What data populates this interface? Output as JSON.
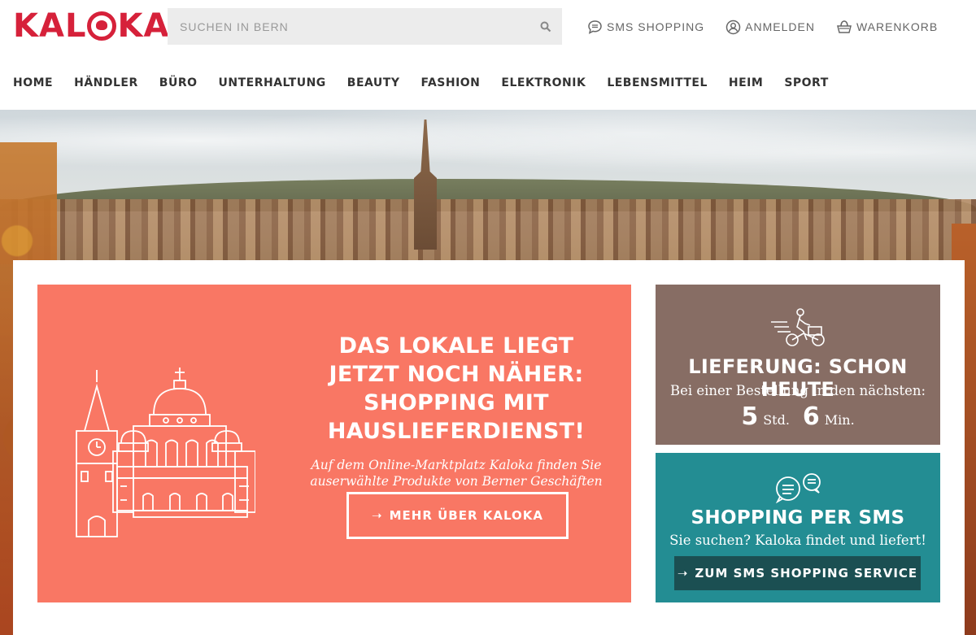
{
  "brand": {
    "logo_text_left": "KAL",
    "logo_text_right": "KA",
    "color": "#d6213a"
  },
  "search": {
    "placeholder": "SUCHEN IN BERN",
    "icon": "search-icon"
  },
  "topnav": [
    {
      "label": "SMS SHOPPING",
      "icon": "chat-bubble-icon"
    },
    {
      "label": "ANMELDEN",
      "icon": "user-icon"
    },
    {
      "label": "WARENKORB",
      "icon": "basket-icon"
    }
  ],
  "categories": [
    "HOME",
    "HÄNDLER",
    "BÜRO",
    "UNTERHALTUNG",
    "BEAUTY",
    "FASHION",
    "ELEKTRONIK",
    "LEBENSMITTEL",
    "HEIM",
    "SPORT"
  ],
  "promo": {
    "heading": "DAS LOKALE LIEGT JETZT NOCH NÄHER: SHOPPING MIT HAUSLIEFERDIENST!",
    "subtitle": "Auf dem Online-Marktplatz Kaloka finden Sie auserwählte Produkte von Berner Geschäften",
    "button_label": "MEHR ÜBER KALOKA",
    "arrow": "➝",
    "color": "#f97764"
  },
  "delivery": {
    "heading": "LIEFERUNG: SCHON HEUTE",
    "line": "Bei einer Bestellung in den nächsten:",
    "hours": "5",
    "hours_unit": "Std.",
    "minutes": "6",
    "minutes_unit": "Min.",
    "icon": "delivery-bike-icon",
    "color": "#876d64"
  },
  "sms": {
    "heading": "SHOPPING PER SMS",
    "line": "Sie suchen? Kaloka findet und liefert!",
    "button_label": "ZUM SMS SHOPPING SERVICE",
    "arrow": "➝",
    "icon": "chat-bubbles-icon",
    "color": "#238d93"
  }
}
